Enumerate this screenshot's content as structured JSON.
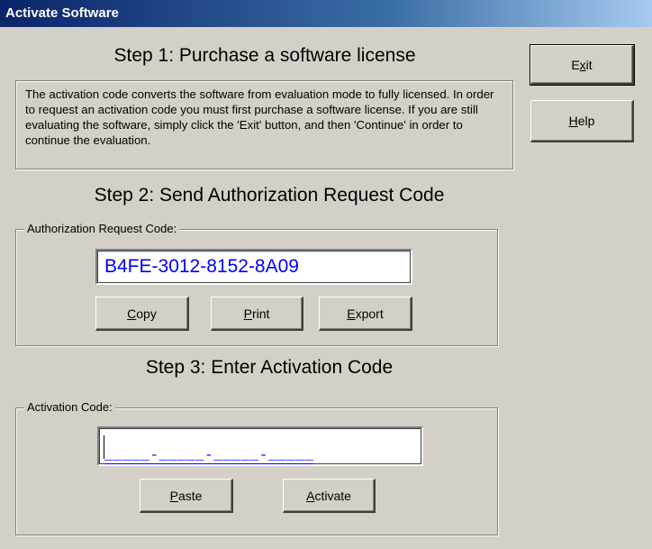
{
  "window": {
    "title": "Activate Software"
  },
  "step1": {
    "heading": "Step 1: Purchase a software license",
    "description": "The activation code converts the software from evaluation mode to fully licensed.  In order to request an activation code you must first purchase a software license.  If you are still evaluating the software, simply click the 'Exit' button, and then 'Continue' in order to continue the evaluation."
  },
  "step2": {
    "heading": "Step 2: Send Authorization Request Code",
    "group_label": "Authorization Request Code:",
    "code": "B4FE-3012-8152-8A09",
    "buttons": {
      "copy": {
        "mnemonic": "C",
        "rest": "opy"
      },
      "print": {
        "mnemonic": "P",
        "rest": "rint"
      },
      "export": {
        "mnemonic": "E",
        "rest": "xport"
      }
    }
  },
  "step3": {
    "heading": "Step 3: Enter Activation Code",
    "group_label": "Activation Code:",
    "input_mask": "_____-_____-_____-_____",
    "buttons": {
      "paste": {
        "mnemonic": "P",
        "rest": "aste"
      },
      "activate": {
        "mnemonic": "A",
        "rest": "ctivate"
      }
    }
  },
  "side_buttons": {
    "exit": {
      "before": "E",
      "mnemonic": "x",
      "rest": "it"
    },
    "help": {
      "mnemonic": "H",
      "rest": "elp"
    }
  },
  "colors": {
    "titlebar_start": "#0a246a",
    "titlebar_end": "#a6caf0",
    "face": "#d4d0c8",
    "code_text": "#0000ff"
  }
}
